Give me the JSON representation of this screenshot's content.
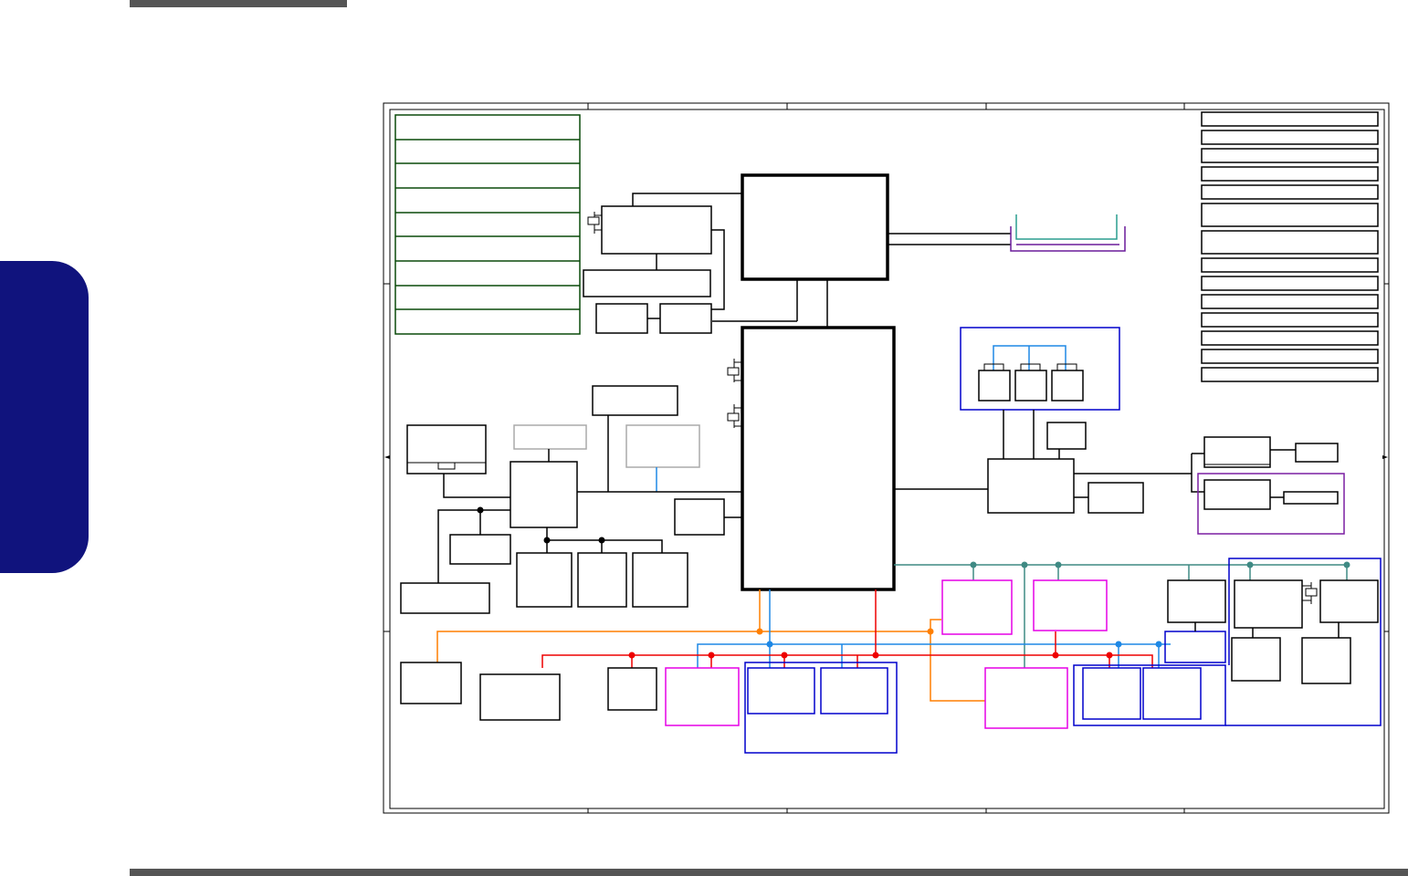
{
  "colors": {
    "page_rule": "#555555",
    "side_tab": "#10137d",
    "block_outline": "#000000",
    "memory_slot_outline": "#0a4a0a",
    "disabled_block_outline": "#aaaaaa",
    "group_outline_blue": "#0000cc",
    "group_outline_magenta": "#e600e6",
    "group_outline_purple": "#7a1fa2",
    "bus_teal": "#3f8a84",
    "bus_orange": "#ff7f00",
    "bus_red": "#ee0000",
    "bus_blue": "#1e88e5",
    "connector_teal": "#2a9d8f",
    "connector_purple": "#6a1b9a"
  },
  "icons": {
    "crystal": "crystal-oscillator-icon",
    "junction": "junction-dot-icon"
  }
}
